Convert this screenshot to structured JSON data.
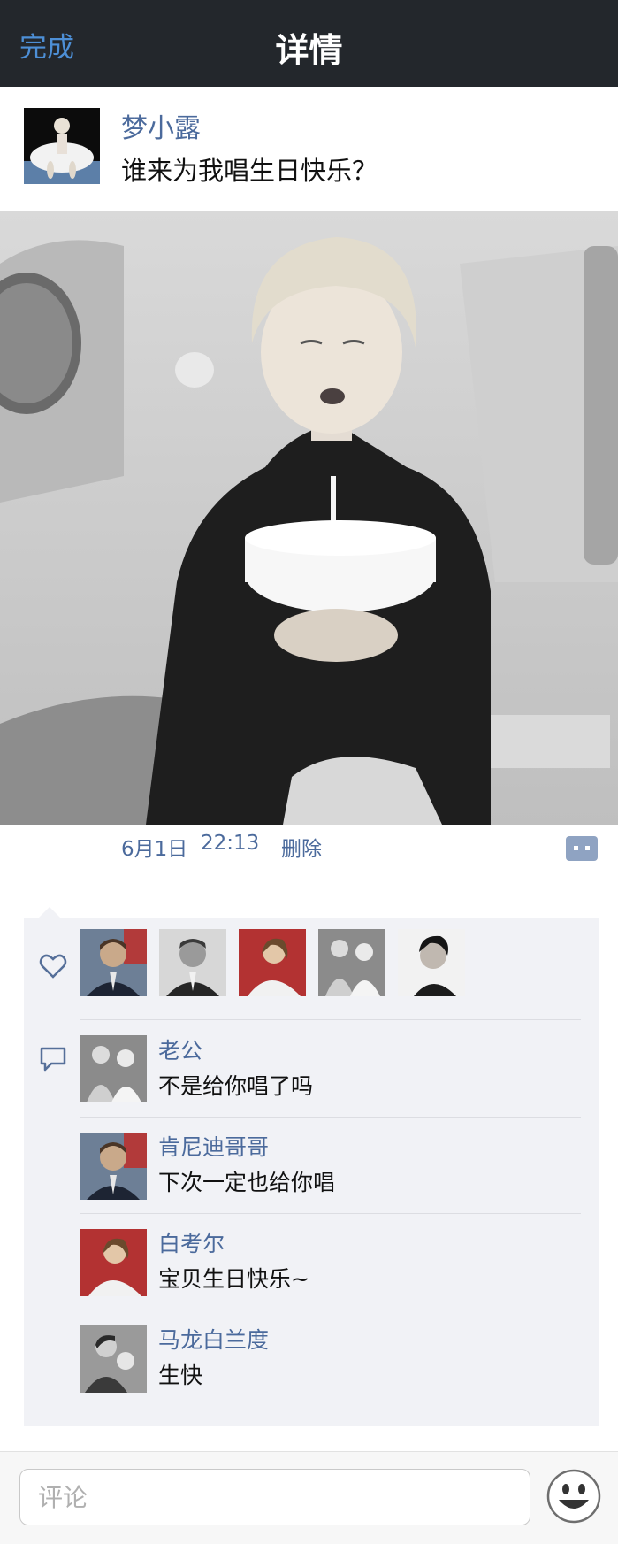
{
  "navbar": {
    "done_label": "完成",
    "title": "详情"
  },
  "post": {
    "author": "梦小露",
    "text": "谁来为我唱生日快乐？",
    "date": "6月1日",
    "time": "22:13",
    "delete_label": "删除"
  },
  "likes": {
    "users": [
      "kennedy-portrait",
      "robert-portrait",
      "bacall-portrait",
      "couple-portrait",
      "elvis-portrait"
    ]
  },
  "comments": [
    {
      "name": "老公",
      "text": "不是给你唱了吗"
    },
    {
      "name": "肯尼迪哥哥",
      "text": "下次一定也给你唱"
    },
    {
      "name": "白考尔",
      "text": "宝贝生日快乐~"
    },
    {
      "name": "马龙白兰度",
      "text": "生快"
    }
  ],
  "composer": {
    "placeholder": "评论"
  },
  "colors": {
    "navbar": "#23272c",
    "link_blue": "#4b6a9c",
    "done_blue": "#4d8fd6",
    "panel_bg": "#f1f2f6"
  }
}
